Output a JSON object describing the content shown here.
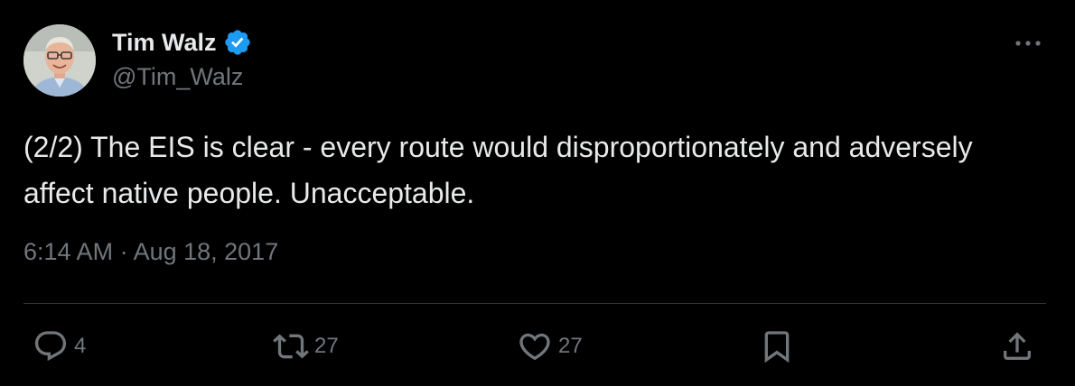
{
  "author": {
    "display_name": "Tim Walz",
    "handle": "@Tim_Walz",
    "verified": true,
    "verified_color": "#1d9bf0",
    "avatar_icon": "profile-photo"
  },
  "tweet": {
    "text": "(2/2) The EIS is clear - every route would disproportionately and adversely affect native people. Unacceptable.",
    "timestamp": "6:14 AM · Aug 18, 2017"
  },
  "actions": {
    "reply_count": "4",
    "retweet_count": "27",
    "like_count": "27"
  },
  "colors": {
    "background": "#000000",
    "primary_text": "#e7e9ea",
    "secondary_text": "#71767b",
    "divider": "#2f3336"
  },
  "icons": [
    "verified-badge-icon",
    "more-icon",
    "reply-icon",
    "retweet-icon",
    "like-icon",
    "bookmark-icon",
    "share-icon"
  ]
}
